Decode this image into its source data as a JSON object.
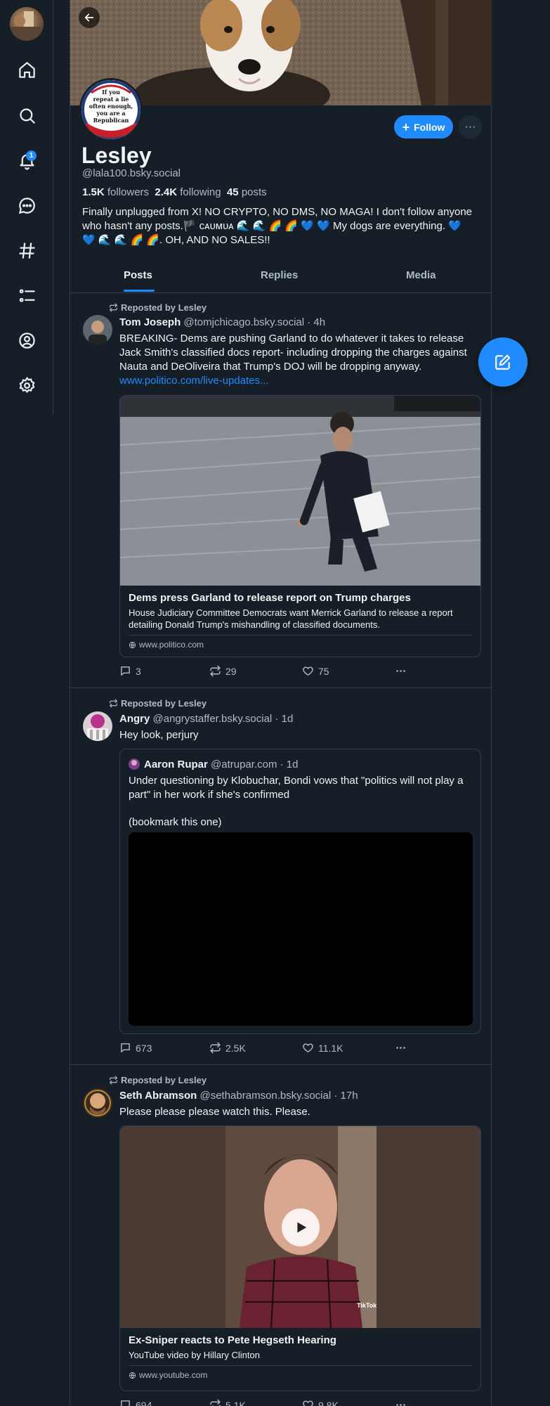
{
  "nav": {
    "notifications_badge": "1"
  },
  "profile": {
    "avatar_text": [
      "If you",
      "repeat a lie",
      "often enough,",
      "you are a",
      "Republican"
    ],
    "follow_label": "Follow",
    "more_label": "···",
    "name": "Lesley",
    "handle": "@lala100.bsky.social",
    "followers_count": "1.5K",
    "followers_label": "followers",
    "following_count": "2.4K",
    "following_label": "following",
    "posts_count": "45",
    "posts_label": "posts",
    "bio": "Finally unplugged from X! NO CRYPTO, NO DMS, NO MAGA! I don't follow anyone who hasn't any posts.🏴 ᴄᴀᴜᴍᴜᴀ 🌊 🌊 🌈 🌈 💙 💙 My dogs are everything. 💙 💙 🌊 🌊 🌈 🌈. OH, AND NO SALES!!"
  },
  "tabs": [
    "Posts",
    "Replies",
    "Media"
  ],
  "posts": [
    {
      "repost_label": "Reposted by Lesley",
      "author": "Tom Joseph",
      "handle": "@tomjchicago.bsky.social",
      "time": "· 4h",
      "text": "BREAKING- Dems are pushing Garland to do whatever it takes to release Jack Smith's classified docs report- including dropping the charges against Nauta and DeOliveira that Trump's DOJ will be dropping anyway.",
      "link": "www.politico.com/live-updates...",
      "card_title": "Dems press Garland to release report on Trump charges",
      "card_desc": "House Judiciary Committee Democrats want Merrick Garland to release a report detailing Donald Trump's mishandling of classified documents.",
      "card_domain": "www.politico.com",
      "replies": "3",
      "reposts": "29",
      "likes": "75"
    },
    {
      "repost_label": "Reposted by Lesley",
      "author": "Angry",
      "handle": "@angrystaffer.bsky.social",
      "time": "· 1d",
      "text": "Hey look, perjury",
      "quote_author": "Aaron Rupar",
      "quote_handle": "@atrupar.com",
      "quote_time": "· 1d",
      "quote_text": "Under questioning by Klobuchar, Bondi vows that \"politics will not play a part\" in her work if she's confirmed",
      "quote_text2": "(bookmark this one)",
      "replies": "673",
      "reposts": "2.5K",
      "likes": "11.1K"
    },
    {
      "repost_label": "Reposted by Lesley",
      "author": "Seth Abramson",
      "handle": "@sethabramson.bsky.social",
      "time": "· 17h",
      "text": "Please please please watch this. Please.",
      "video_watermark": "TikTok",
      "card_title": "Ex-Sniper reacts to Pete Hegseth Hearing",
      "card_desc": "YouTube video by Hillary Clinton",
      "card_domain": "www.youtube.com",
      "replies": "694",
      "reposts": "5.1K",
      "likes": "9.8K"
    }
  ],
  "colors": {
    "background": "#161e27",
    "accent": "#208bfe",
    "border": "#2e4052",
    "muted_text": "#aebbc9"
  }
}
